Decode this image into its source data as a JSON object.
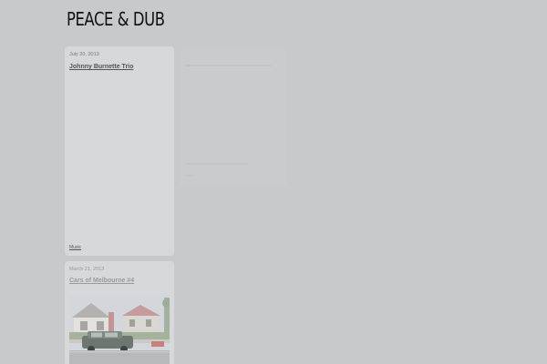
{
  "site": {
    "title": "PEACE & DUB"
  },
  "posts": [
    {
      "date": "July 20, 2013",
      "title": "Johnny Burnette Trio",
      "tag": "Music"
    },
    {
      "date": "March 21, 2013",
      "title": "Cars of Melbourne #4",
      "image": "photo-houses-and-car"
    }
  ]
}
